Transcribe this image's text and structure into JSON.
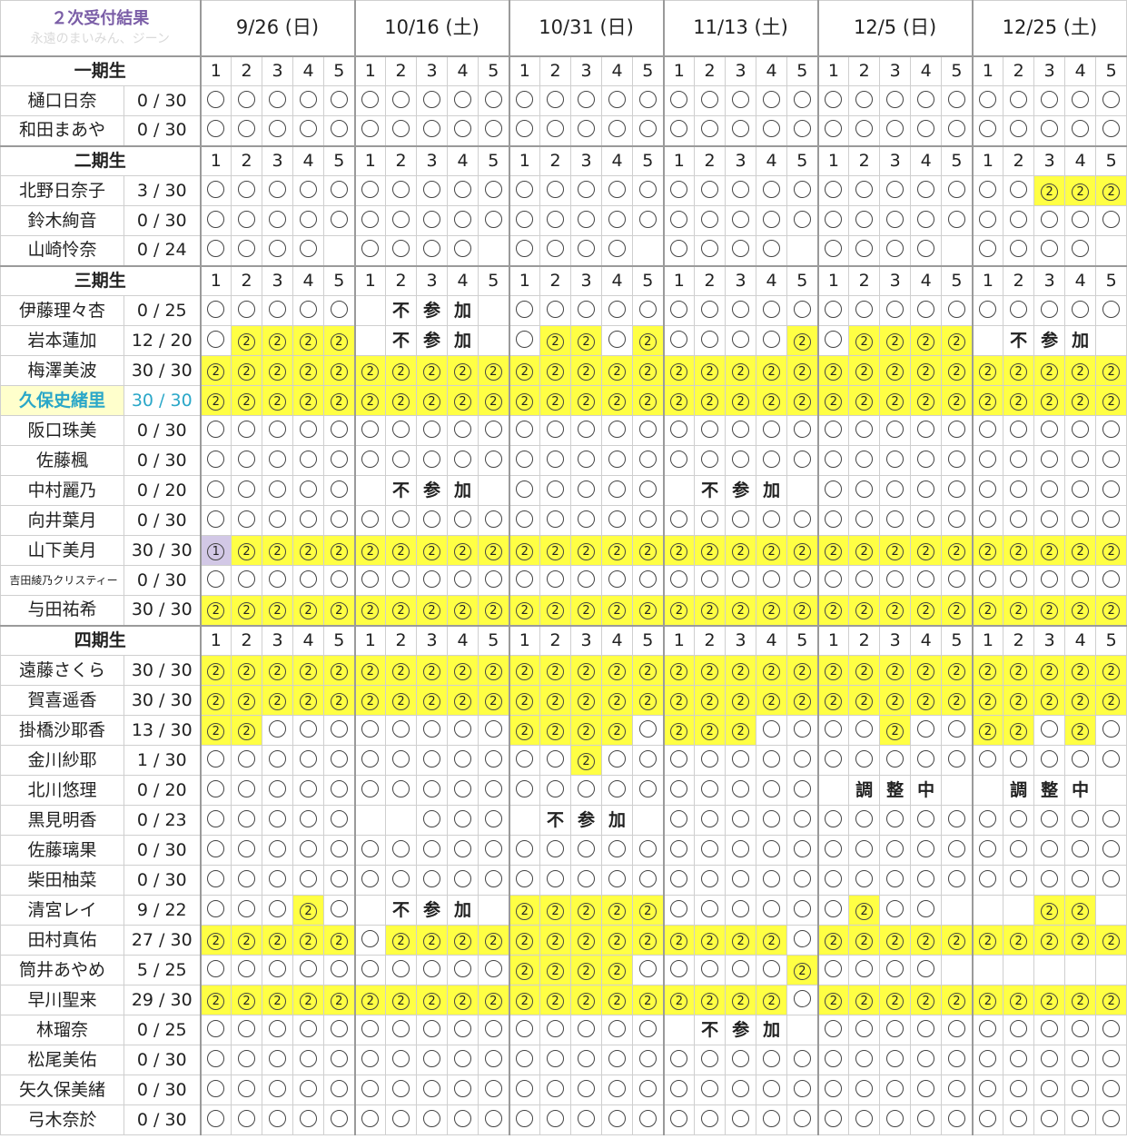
{
  "title": "２次受付結果",
  "subtitle": "永遠のまいみん、ジーン",
  "dates": [
    "9/26 (日)",
    "10/16 (土)",
    "10/31 (日)",
    "11/13 (土)",
    "12/5 (日)",
    "12/25 (土)"
  ],
  "part_numbers": [
    "1",
    "2",
    "3",
    "4",
    "5"
  ],
  "score_separator": "/",
  "special_labels": {
    "not_joining": "不参加",
    "adjusting": "調整中"
  },
  "legend_symbols": {
    "empty": "",
    "one": "1",
    "two": "2"
  },
  "groups": [
    {
      "label": "一期生",
      "members": [
        {
          "name": "樋口日奈",
          "won": "0",
          "total": "30",
          "cells": "000000000000000000000000000000"
        },
        {
          "name": "和田まあや",
          "won": "0",
          "total": "30",
          "cells": "000000000000000000000000000000"
        }
      ]
    },
    {
      "label": "二期生",
      "members": [
        {
          "name": "北野日奈子",
          "won": "3",
          "total": "30",
          "cells": "000000000000000000000000000222"
        },
        {
          "name": "鈴木絢音",
          "won": "0",
          "total": "30",
          "cells": "000000000000000000000000000000"
        },
        {
          "name": "山崎怜奈",
          "won": "0",
          "total": "24",
          "cells": "0000-0000-0000-0000-0000-0000-"
        }
      ]
    },
    {
      "label": "三期生",
      "members": [
        {
          "name": "伊藤理々杏",
          "won": "0",
          "total": "25",
          "cells": "00000NNNNN00000000000000000000"
        },
        {
          "name": "岩本蓮加",
          "won": "12",
          "total": "20",
          "cells": "02222NNNNN022020000202222NNNNN"
        },
        {
          "name": "梅澤美波",
          "won": "30",
          "total": "30",
          "cells": "222222222222222222222222222222"
        },
        {
          "name": "久保史緒里",
          "won": "30",
          "total": "30",
          "cells": "222222222222222222222222222222",
          "highlight": true
        },
        {
          "name": "阪口珠美",
          "won": "0",
          "total": "30",
          "cells": "000000000000000000000000000000"
        },
        {
          "name": "佐藤楓",
          "won": "0",
          "total": "30",
          "cells": "000000000000000000000000000000"
        },
        {
          "name": "中村麗乃",
          "won": "0",
          "total": "20",
          "cells": "00000NNNNN00000NNNNN0000000000"
        },
        {
          "name": "向井葉月",
          "won": "0",
          "total": "30",
          "cells": "000000000000000000000000000000"
        },
        {
          "name": "山下美月",
          "won": "30",
          "total": "30",
          "cells": "122222222222222222222222222222"
        },
        {
          "name": "吉田綾乃クリスティー",
          "won": "0",
          "total": "30",
          "cells": "000000000000000000000000000000",
          "small": true
        },
        {
          "name": "与田祐希",
          "won": "30",
          "total": "30",
          "cells": "222222222222222222222222222222"
        }
      ]
    },
    {
      "label": "四期生",
      "members": [
        {
          "name": "遠藤さくら",
          "won": "30",
          "total": "30",
          "cells": "222222222222222222222222222222"
        },
        {
          "name": "賀喜遥香",
          "won": "30",
          "total": "30",
          "cells": "222222222222222222222222222222"
        },
        {
          "name": "掛橋沙耶香",
          "won": "13",
          "total": "30",
          "cells": "220000000022220222000020022020"
        },
        {
          "name": "金川紗耶",
          "won": "1",
          "total": "30",
          "cells": "000000000000200000000000000000"
        },
        {
          "name": "北川悠理",
          "won": "0",
          "total": "20",
          "cells": "00000000000000000000AAAAAAAAAA"
        },
        {
          "name": "黒見明香",
          "won": "0",
          "total": "23",
          "cells": "00000--000NNNNN000000000000000"
        },
        {
          "name": "佐藤璃果",
          "won": "0",
          "total": "30",
          "cells": "000000000000000000000000000000"
        },
        {
          "name": "柴田柚菜",
          "won": "0",
          "total": "30",
          "cells": "000000000000000000000000000000"
        },
        {
          "name": "清宮レイ",
          "won": "9",
          "total": "22",
          "cells": "00020NNNNN22222000000200---22"
        },
        {
          "name": "田村真佑",
          "won": "27",
          "total": "30",
          "cells": "222220222222222222202222222222"
        },
        {
          "name": "筒井あやめ",
          "won": "5",
          "total": "25",
          "cells": "000000000022220000020000NNNNN"
        },
        {
          "name": "早川聖来",
          "won": "29",
          "total": "30",
          "cells": "222222222222222222202222222222"
        },
        {
          "name": "林瑠奈",
          "won": "0",
          "total": "25",
          "cells": "000000000000000NNNNN0000000000"
        },
        {
          "name": "松尾美佑",
          "won": "0",
          "total": "30",
          "cells": "000000000000000000000000000000"
        },
        {
          "name": "矢久保美緒",
          "won": "0",
          "total": "30",
          "cells": "000000000000000000000000000000"
        },
        {
          "name": "弓木奈於",
          "won": "0",
          "total": "30",
          "cells": "000000000000000000000000000000"
        }
      ]
    }
  ],
  "colors": {
    "won_cell": "#ffff44",
    "first_cell": "#d2c8e6",
    "title": "#7b5ea7",
    "highlight_text": "#2aa7c8",
    "highlight_bg": "#ffffcc"
  }
}
